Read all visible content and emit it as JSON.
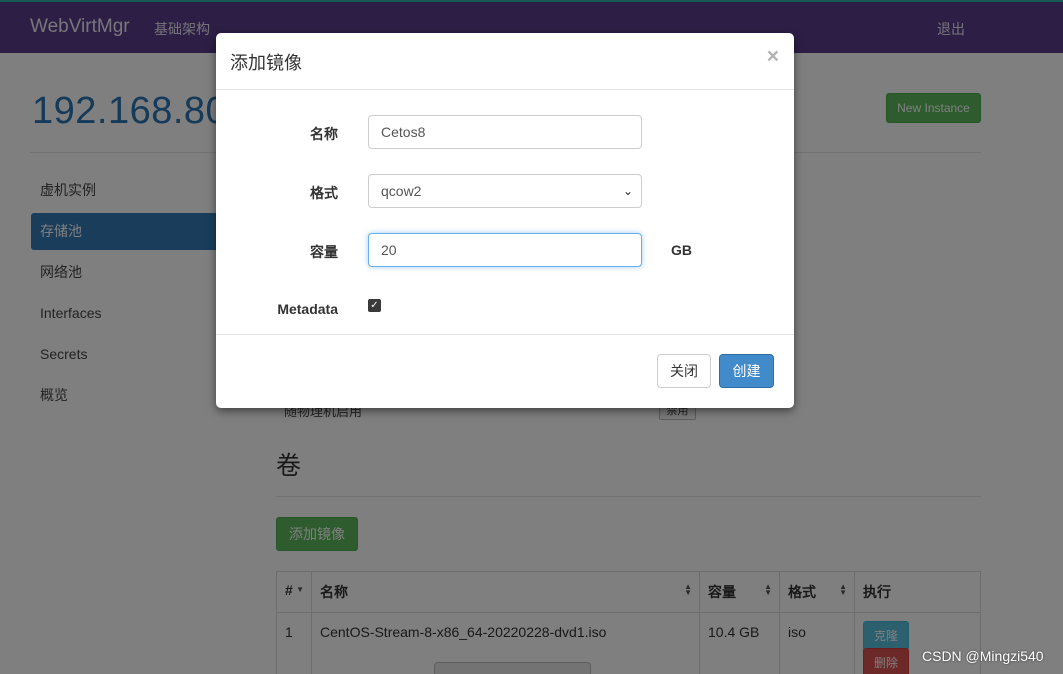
{
  "navbar": {
    "brand": "WebVirtMgr",
    "infrastructure_link": "基础架构",
    "logout_link": "退出"
  },
  "page": {
    "host_title": "192.168.80.",
    "new_instance_label": "New Instance"
  },
  "sidebar": {
    "items": [
      {
        "label": "虚机实例"
      },
      {
        "label": "存储池"
      },
      {
        "label": "网络池"
      },
      {
        "label": "Interfaces"
      },
      {
        "label": "Secrets"
      },
      {
        "label": "概览"
      }
    ]
  },
  "pool": {
    "autostart_label": "随物理机启用",
    "autostart_state": "禁用"
  },
  "volumes": {
    "section_title": "卷",
    "add_image_label": "添加镜像",
    "headers": [
      "#",
      "名称",
      "容量",
      "格式",
      "执行"
    ],
    "rows": [
      {
        "index": "1",
        "name": "CentOS-Stream-8-x86_64-20220228-dvd1.iso",
        "size": "10.4 GB",
        "format": "iso",
        "clone_label": "克隆",
        "delete_label": "删除"
      }
    ]
  },
  "modal": {
    "title": "添加镜像",
    "close_glyph": "×",
    "fields": {
      "name_label": "名称",
      "name_value": "Cetos8",
      "format_label": "格式",
      "format_value": "qcow2",
      "capacity_label": "容量",
      "capacity_value": "20",
      "capacity_unit": "GB",
      "metadata_label": "Metadata",
      "metadata_checked": true
    },
    "close_button": "关闭",
    "create_button": "创建"
  },
  "watermark": "CSDN @Mingzi540",
  "colors": {
    "navbar": "#5a3d8a",
    "primary": "#337ab7",
    "success": "#5cb85c",
    "info": "#5bc0de",
    "danger": "#d9534f"
  }
}
